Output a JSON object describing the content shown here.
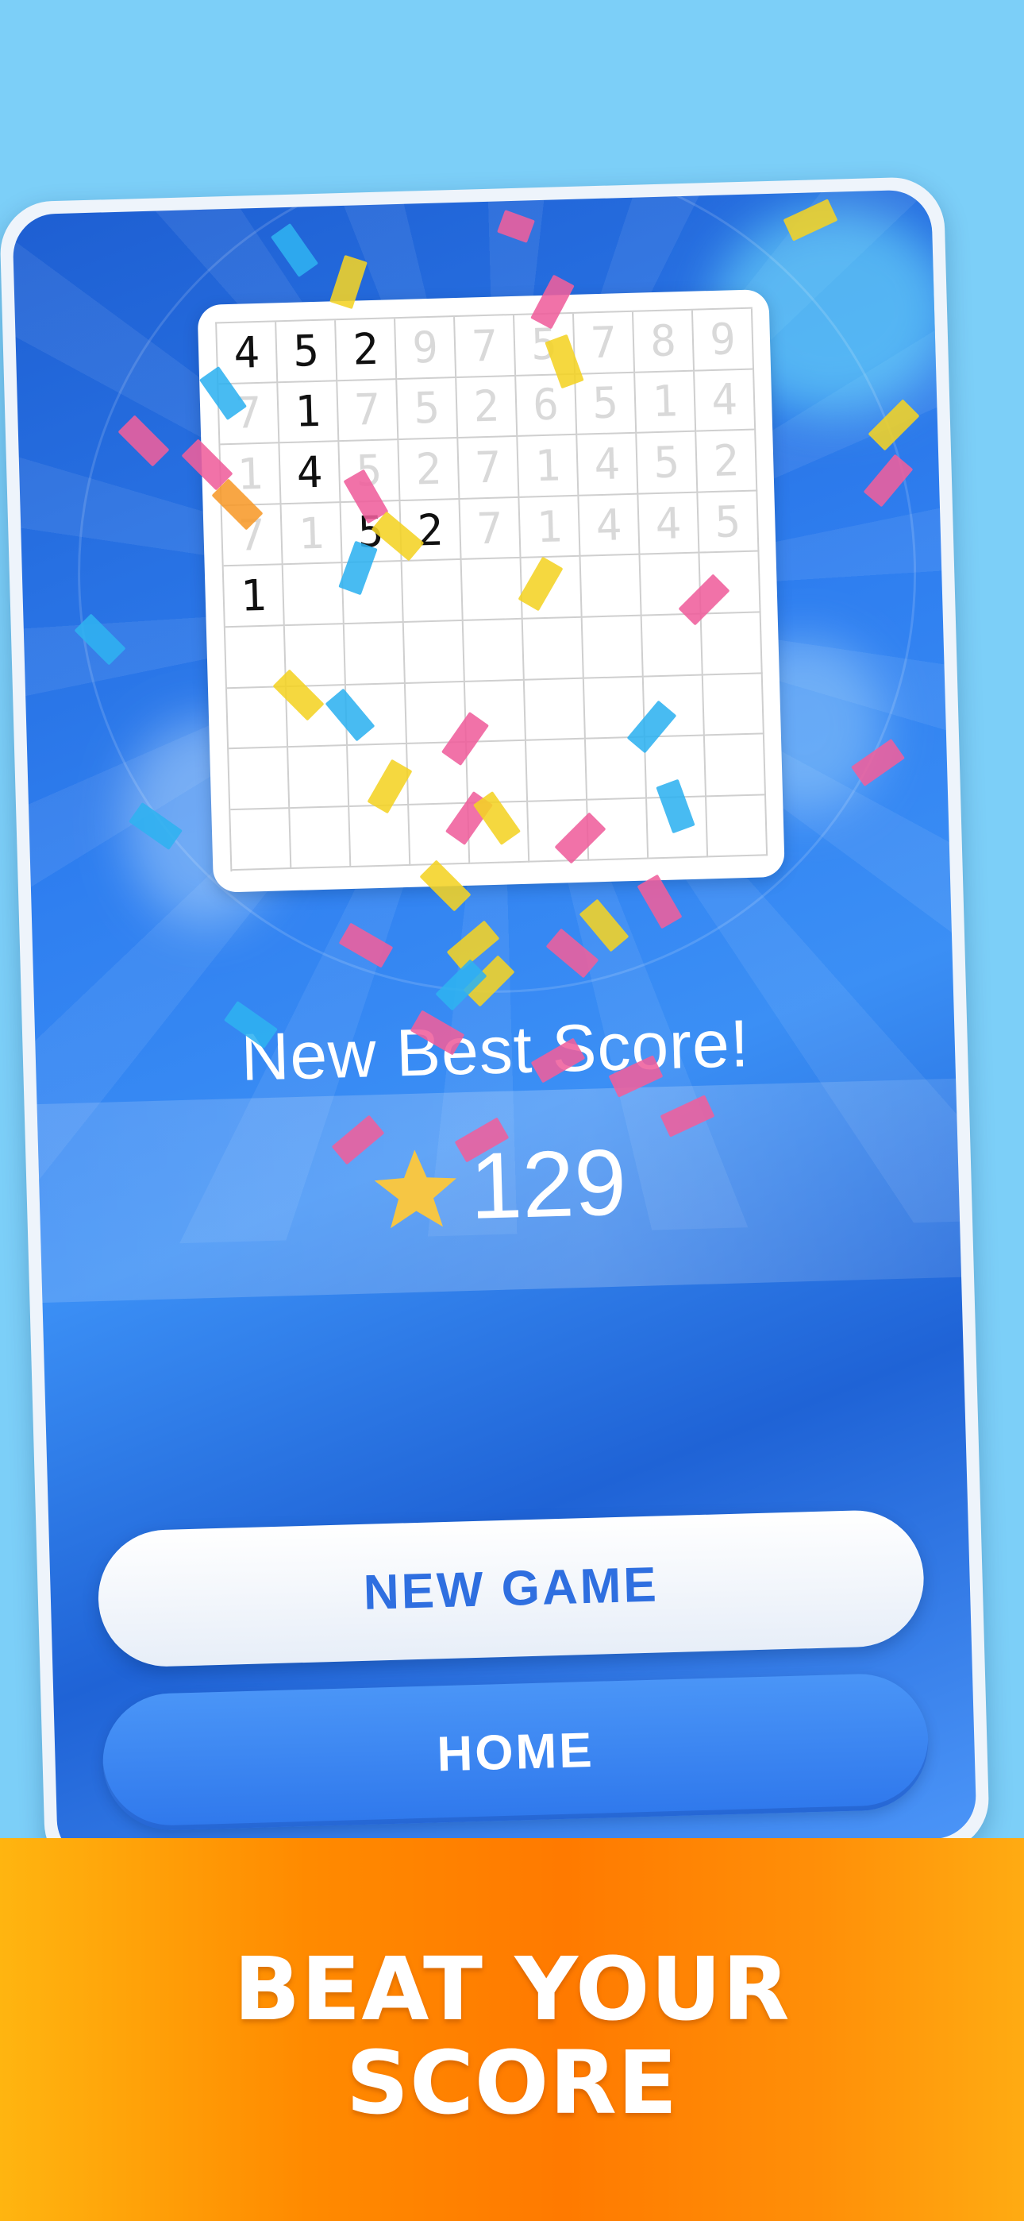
{
  "colors": {
    "background": "#7ccff8",
    "card_blue": "#2f7ff0",
    "button_text_blue": "#2f6fe0",
    "star": "#f6c644",
    "banner_orange": "#ff8a00"
  },
  "board": {
    "rows": [
      [
        "4",
        "5",
        "2",
        "9",
        "7",
        "5",
        "7",
        "8",
        "9"
      ],
      [
        "7",
        "1",
        "7",
        "5",
        "2",
        "6",
        "5",
        "1",
        "4"
      ],
      [
        "1",
        "4",
        "5",
        "2",
        "7",
        "1",
        "4",
        "5",
        "2"
      ],
      [
        "7",
        "1",
        "5",
        "2",
        "7",
        "1",
        "4",
        "4",
        "5"
      ],
      [
        "1",
        "",
        "",
        "",
        "",
        "",
        "",
        "",
        ""
      ],
      [
        "",
        "",
        "",
        "",
        "",
        "",
        "",
        "",
        ""
      ],
      [
        "",
        "",
        "",
        "",
        "",
        "",
        "",
        "",
        ""
      ],
      [
        "",
        "",
        "",
        "",
        "",
        "",
        "",
        "",
        ""
      ],
      [
        "",
        "",
        "",
        "",
        "",
        "",
        "",
        "",
        ""
      ]
    ],
    "active": [
      [
        0,
        0
      ],
      [
        0,
        1
      ],
      [
        0,
        2
      ],
      [
        1,
        1
      ],
      [
        2,
        1
      ],
      [
        3,
        2
      ],
      [
        3,
        3
      ],
      [
        4,
        0
      ]
    ]
  },
  "result": {
    "title": "New Best Score!",
    "star_icon": "star-icon",
    "score": "129"
  },
  "buttons": {
    "new_game": "NEW GAME",
    "home": "HOME"
  },
  "banner": {
    "line1": "BEAT YOUR",
    "line2": "SCORE"
  }
}
